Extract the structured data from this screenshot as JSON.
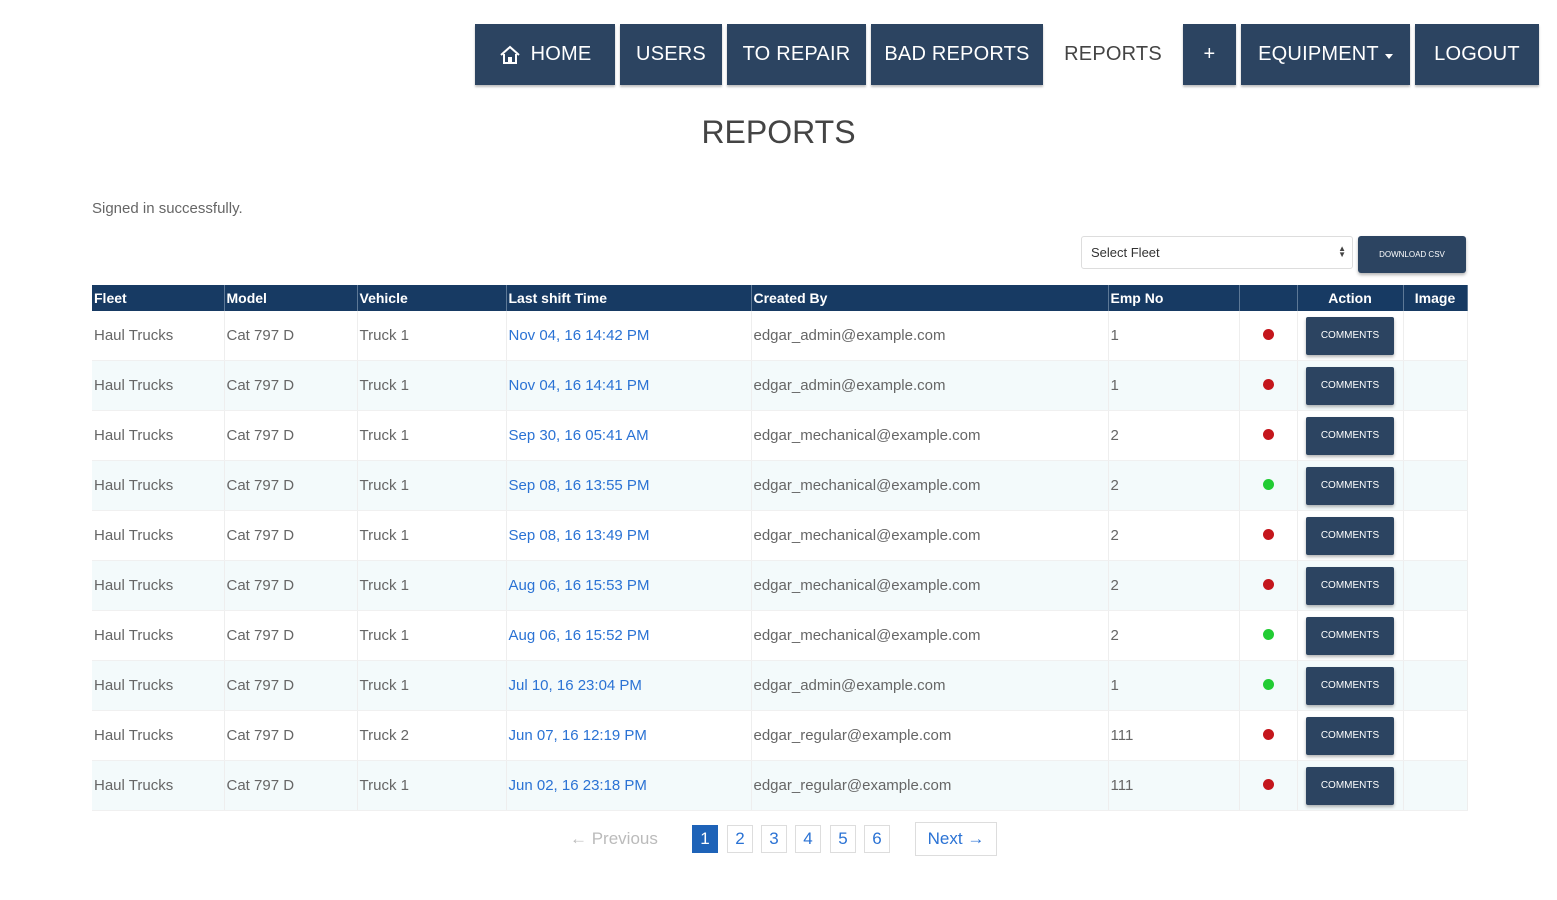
{
  "nav": {
    "home": "HOME",
    "users": "USERS",
    "to_repair": "TO REPAIR",
    "bad_reports": "BAD REPORTS",
    "reports": "REPORTS",
    "plus": "+",
    "equipment": "EQUIPMENT",
    "logout": "LOGOUT"
  },
  "page": {
    "title": "REPORTS",
    "flash": "Signed in successfully."
  },
  "controls": {
    "select_fleet": "Select Fleet",
    "download_csv": "DOWNLOAD CSV"
  },
  "table": {
    "headers": [
      "Fleet",
      "Model",
      "Vehicle",
      "Last shift Time",
      "Created By",
      "Emp No",
      "",
      "Action",
      "Image"
    ],
    "action_label": "COMMENTS",
    "rows": [
      {
        "fleet": "Haul Trucks",
        "model": "Cat 797 D",
        "vehicle": "Truck 1",
        "time": "Nov 04, 16 14:42 PM",
        "created_by": "edgar_admin@example.com",
        "emp_no": "1",
        "status": "red"
      },
      {
        "fleet": "Haul Trucks",
        "model": "Cat 797 D",
        "vehicle": "Truck 1",
        "time": "Nov 04, 16 14:41 PM",
        "created_by": "edgar_admin@example.com",
        "emp_no": "1",
        "status": "red"
      },
      {
        "fleet": "Haul Trucks",
        "model": "Cat 797 D",
        "vehicle": "Truck 1",
        "time": "Sep 30, 16 05:41 AM",
        "created_by": "edgar_mechanical@example.com",
        "emp_no": "2",
        "status": "red"
      },
      {
        "fleet": "Haul Trucks",
        "model": "Cat 797 D",
        "vehicle": "Truck 1",
        "time": "Sep 08, 16 13:55 PM",
        "created_by": "edgar_mechanical@example.com",
        "emp_no": "2",
        "status": "green"
      },
      {
        "fleet": "Haul Trucks",
        "model": "Cat 797 D",
        "vehicle": "Truck 1",
        "time": "Sep 08, 16 13:49 PM",
        "created_by": "edgar_mechanical@example.com",
        "emp_no": "2",
        "status": "red"
      },
      {
        "fleet": "Haul Trucks",
        "model": "Cat 797 D",
        "vehicle": "Truck 1",
        "time": "Aug 06, 16 15:53 PM",
        "created_by": "edgar_mechanical@example.com",
        "emp_no": "2",
        "status": "red"
      },
      {
        "fleet": "Haul Trucks",
        "model": "Cat 797 D",
        "vehicle": "Truck 1",
        "time": "Aug 06, 16 15:52 PM",
        "created_by": "edgar_mechanical@example.com",
        "emp_no": "2",
        "status": "green"
      },
      {
        "fleet": "Haul Trucks",
        "model": "Cat 797 D",
        "vehicle": "Truck 1",
        "time": "Jul 10, 16 23:04 PM",
        "created_by": "edgar_admin@example.com",
        "emp_no": "1",
        "status": "green"
      },
      {
        "fleet": "Haul Trucks",
        "model": "Cat 797 D",
        "vehicle": "Truck 2",
        "time": "Jun 07, 16 12:19 PM",
        "created_by": "edgar_regular@example.com",
        "emp_no": "111",
        "status": "red"
      },
      {
        "fleet": "Haul Trucks",
        "model": "Cat 797 D",
        "vehicle": "Truck 1",
        "time": "Jun 02, 16 23:18 PM",
        "created_by": "edgar_regular@example.com",
        "emp_no": "111",
        "status": "red"
      }
    ]
  },
  "pagination": {
    "previous": "← Previous",
    "pages": [
      "1",
      "2",
      "3",
      "4",
      "5",
      "6"
    ],
    "current": "1",
    "next": "Next →"
  },
  "colors": {
    "nav_bg": "#2c4461",
    "table_header_bg": "#173a63",
    "link": "#2a72d4",
    "status_red": "#c4161c",
    "status_green": "#22cc33"
  }
}
